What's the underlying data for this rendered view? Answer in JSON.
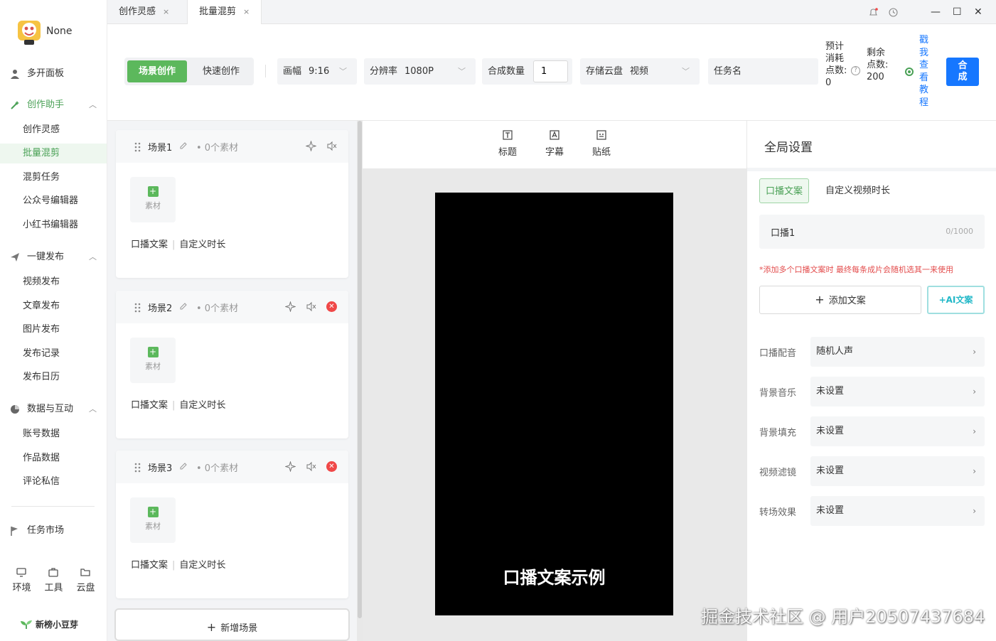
{
  "user": {
    "name": "None"
  },
  "sidebar": {
    "top_item": "多开面板",
    "groups": [
      {
        "label": "创作助手",
        "items": [
          "创作灵感",
          "批量混剪",
          "混剪任务",
          "公众号编辑器",
          "小红书编辑器"
        ]
      },
      {
        "label": "一键发布",
        "items": [
          "视频发布",
          "文章发布",
          "图片发布",
          "发布记录",
          "发布日历"
        ]
      },
      {
        "label": "数据与互动",
        "items": [
          "账号数据",
          "作品数据",
          "评论私信"
        ]
      }
    ],
    "market": "任务市场",
    "tools": [
      "环境",
      "工具",
      "云盘"
    ],
    "brand": "新榜小豆芽",
    "active_item": "批量混剪"
  },
  "tabs": [
    {
      "label": "创作灵感",
      "close": "×"
    },
    {
      "label": "批量混剪",
      "close": "×"
    }
  ],
  "window": {
    "minimize": "—",
    "maximize": "☐",
    "close": "✕"
  },
  "toolbar": {
    "mode_scene": "场景创作",
    "mode_quick": "快速创作",
    "ratio_label": "画幅",
    "ratio_value": "9:16",
    "resolution_label": "分辨率",
    "resolution_value": "1080P",
    "count_label": "合成数量",
    "count_value": "1",
    "storage_label": "存储云盘",
    "storage_value": "视频",
    "task_placeholder": "任务名",
    "est_points": "预计消耗点数:",
    "est_points_value": "0",
    "remaining_points": "剩余点数:",
    "remaining_points_value": "200",
    "help": "?",
    "tutorial_link": "戳我查看教程",
    "synth_button": "合成"
  },
  "scenes": [
    {
      "name": "场景1",
      "count": "• 0个素材",
      "material": "素材",
      "foot_a": "口播文案",
      "foot_b": "自定义时长",
      "deletable": false
    },
    {
      "name": "场景2",
      "count": "• 0个素材",
      "material": "素材",
      "foot_a": "口播文案",
      "foot_b": "自定义时长",
      "deletable": true
    },
    {
      "name": "场景3",
      "count": "• 0个素材",
      "material": "素材",
      "foot_a": "口播文案",
      "foot_b": "自定义时长",
      "deletable": true
    }
  ],
  "add_scene": "新增场景",
  "preview": {
    "tools": [
      "标题",
      "字幕",
      "贴纸"
    ],
    "caption": "口播文案示例"
  },
  "settings": {
    "title": "全局设置",
    "tab_copy": "口播文案",
    "tab_duration": "自定义视频时长",
    "copy_name": "口播1",
    "copy_count": "0/1000",
    "warning": "*添加多个口播文案时 最终每条成片会随机选其一来使用",
    "add_copy": "添加文案",
    "ai_copy": "+AI文案",
    "rows": [
      {
        "key": "口播配音",
        "value": "随机人声"
      },
      {
        "key": "背景音乐",
        "value": "未设置"
      },
      {
        "key": "背景填充",
        "value": "未设置"
      },
      {
        "key": "视频滤镜",
        "value": "未设置"
      },
      {
        "key": "转场效果",
        "value": "未设置"
      }
    ]
  },
  "watermark": "掘金技术社区 @ 用户20507437684",
  "colors": {
    "accent_green": "#5cb85c",
    "primary_blue": "#1677ff",
    "danger": "#f04848"
  }
}
